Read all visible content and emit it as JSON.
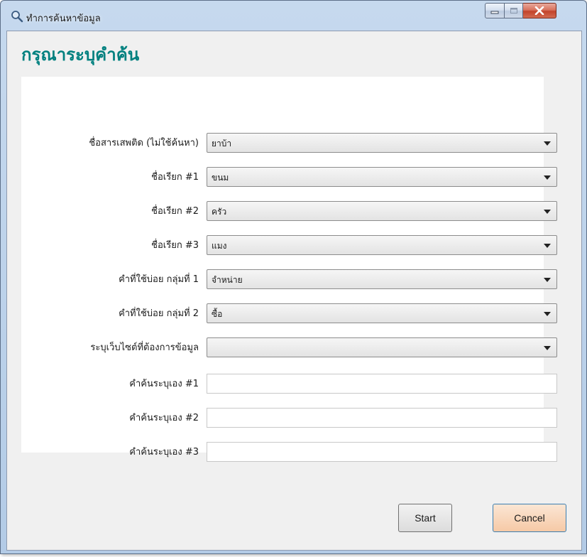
{
  "window": {
    "title": "ทำการค้นหาข้อมูล",
    "icon": "search-icon",
    "controls": [
      "minimize-icon",
      "maximize-icon",
      "close-icon"
    ]
  },
  "form": {
    "heading": "กรุณาระบุคำค้น",
    "combos": [
      {
        "label": "ชื่อสารเสพติด (ไม่ใช้ค้นหา)",
        "value": "ยาบ้า"
      },
      {
        "label": "ชื่อเรียก #1",
        "value": "ขนม"
      },
      {
        "label": "ชื่อเรียก #2",
        "value": "ครัว"
      },
      {
        "label": "ชื่อเรียก #3",
        "value": "แมง"
      },
      {
        "label": "คำที่ใช้บ่อย กลุ่มที่ 1",
        "value": "จำหน่าย"
      },
      {
        "label": "คำที่ใช้บ่อย กลุ่มที่ 2",
        "value": "ซื้อ"
      },
      {
        "label": "ระบุเว็บไซต์ที่ต้องการข้อมูล",
        "value": ""
      }
    ],
    "textboxes": [
      {
        "label": "คำค้นระบุเอง #1",
        "value": ""
      },
      {
        "label": "คำค้นระบุเอง #2",
        "value": ""
      },
      {
        "label": "คำค้นระบุเอง #3",
        "value": ""
      }
    ]
  },
  "buttons": {
    "start": "Start",
    "cancel": "Cancel"
  },
  "colors": {
    "heading": "#00807f",
    "cancel_button": "#f6c9a6",
    "title_bar": "#c6d9ee"
  }
}
